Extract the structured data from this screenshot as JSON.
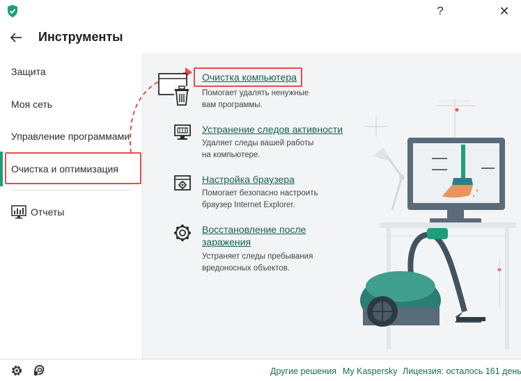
{
  "window": {
    "help_glyph": "?",
    "close_glyph": "✕",
    "accent_color": "#1e9e7a",
    "highlight_color": "#e84b4b"
  },
  "header": {
    "title": "Инструменты"
  },
  "sidebar": {
    "items": [
      {
        "label": "Защита"
      },
      {
        "label": "Моя сеть"
      },
      {
        "label": "Управление программами"
      },
      {
        "label": "Очистка и оптимизация",
        "active": true
      }
    ],
    "reports_label": "Отчеты"
  },
  "tools": [
    {
      "title": "Очистка компьютера",
      "description": "Помогает удалять ненужные вам программы.",
      "desc_lines": [
        "Помогает удалять ненужные",
        "вам программы."
      ],
      "icon": "pc-cleaner-icon"
    },
    {
      "title": "Устранение следов активности",
      "description": "Удаляет следы вашей работы на компьютере.",
      "desc_lines": [
        "Удаляет следы вашей работы",
        "на компьютере."
      ],
      "icon": "activity-traces-icon"
    },
    {
      "title": "Настройка браузера",
      "description": "Помогает безопасно настроить браузер Internet Explorer.",
      "desc_lines": [
        "Помогает безопасно настроить",
        "браузер Internet Explorer."
      ],
      "icon": "browser-settings-icon"
    },
    {
      "title_lines": [
        "Восстановление после",
        "заражения"
      ],
      "description": "Устраняет следы пребывания вредоносных объектов.",
      "desc_lines": [
        "Устраняет следы пребывания",
        "вредоносных объектов."
      ],
      "icon": "recovery-icon"
    }
  ],
  "footer": {
    "other_solutions": "Другие решения",
    "my_kaspersky": "My Kaspersky",
    "license": "Лицензия: осталось 161 день"
  }
}
